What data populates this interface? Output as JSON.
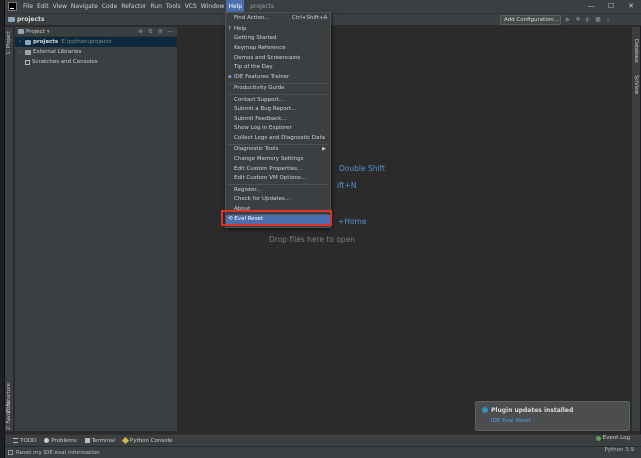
{
  "menubar": {
    "items": [
      "File",
      "Edit",
      "View",
      "Navigate",
      "Code",
      "Refactor",
      "Run",
      "Tools",
      "VCS",
      "Window",
      "Help"
    ],
    "project_label": "projects",
    "window_controls": [
      "—",
      "☐",
      "✕"
    ]
  },
  "navbar": {
    "project": "projects",
    "add_config": "Add Configuration..."
  },
  "project_panel": {
    "header": "Project",
    "tree": [
      {
        "label": "projects",
        "path": "E:\\python\\projects"
      },
      {
        "label": "External Libraries"
      },
      {
        "label": "Scratches and Consoles"
      }
    ]
  },
  "left_stripe": {
    "project": "1: Project",
    "structure": "Z: Structure",
    "favorites": "2: Favorites"
  },
  "right_stripe": {
    "database": "Database",
    "sciview": "SciView"
  },
  "editor_hints": {
    "search_everywhere": "Double Shift",
    "goto_file": "ift+N",
    "navbar": "+Home",
    "drop": "Drop files here to open"
  },
  "help_menu": {
    "items": [
      {
        "label": "Find Action...",
        "shortcut": "Ctrl+Shift+A"
      },
      {
        "label": "Help",
        "icon": "?"
      },
      {
        "label": "Getting Started"
      },
      {
        "label": "Keymap Reference"
      },
      {
        "label": "Demos and Screencasts"
      },
      {
        "label": "Tip of the Day"
      },
      {
        "label": "IDE Features Trainer"
      },
      {
        "label": "Productivity Guide"
      },
      {
        "label": "Contact Support..."
      },
      {
        "label": "Submit a Bug Report..."
      },
      {
        "label": "Submit Feedback..."
      },
      {
        "label": "Show Log in Explorer"
      },
      {
        "label": "Collect Logs and Diagnostic Data"
      },
      {
        "label": "Diagnostic Tools",
        "submenu": "▶"
      },
      {
        "label": "Change Memory Settings"
      },
      {
        "label": "Edit Custom Properties..."
      },
      {
        "label": "Edit Custom VM Options..."
      },
      {
        "label": "Register..."
      },
      {
        "label": "Check for Updates..."
      },
      {
        "label": "About"
      },
      {
        "label": "Eval Reset",
        "icon": "⟲"
      }
    ]
  },
  "bottom_tools": {
    "todo": "TODO",
    "problems": "Problems",
    "terminal": "Terminal",
    "python_console": "Python Console",
    "event_log": "Event Log"
  },
  "notification": {
    "title": "Plugin updates installed",
    "link": "IDE Eval Reset"
  },
  "statusbar": {
    "message": "Reset my IDE eval information",
    "python": "Python 3.9"
  },
  "colors": {
    "accent": "#4b6eaf",
    "hint_blue": "#5a90d0",
    "highlight_box": "#e0302e"
  }
}
